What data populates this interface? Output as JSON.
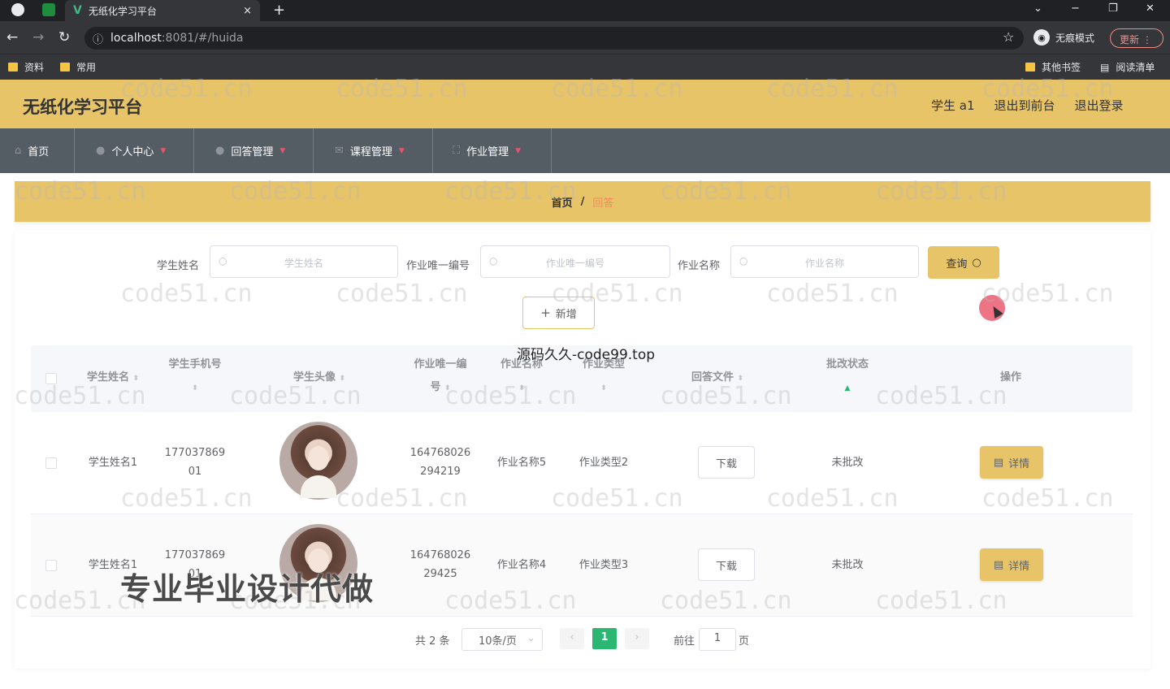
{
  "browser": {
    "tab_title": "无纸化学习平台",
    "tab_close": "×",
    "new_tab": "+",
    "url_host": "localhost",
    "url_path": ":8081/#/huida",
    "incognito_label": "无痕模式",
    "update_label": "更新",
    "win_minimize": "−",
    "win_restore": "❐",
    "win_close": "✕",
    "tab_list": "⌄",
    "bookmarks_left": [
      "资料",
      "常用"
    ],
    "bookmarks_right": [
      "其他书签",
      "阅读清单"
    ]
  },
  "app": {
    "title": "无纸化学习平台",
    "user_label": "学生 a1",
    "back_front": "退出到前台",
    "logout": "退出登录"
  },
  "menu": [
    {
      "label": "首页",
      "icon": "home-icon",
      "has_caret": false
    },
    {
      "label": "个人中心",
      "icon": "user-icon",
      "has_caret": true
    },
    {
      "label": "回答管理",
      "icon": "bulb-icon",
      "has_caret": true
    },
    {
      "label": "课程管理",
      "icon": "mail-icon",
      "has_caret": true
    },
    {
      "label": "作业管理",
      "icon": "crop-icon",
      "has_caret": true
    }
  ],
  "breadcrumb": {
    "home": "首页",
    "separator": "/",
    "current": "回答"
  },
  "search": {
    "fields": [
      {
        "label": "学生姓名",
        "placeholder": "学生姓名"
      },
      {
        "label": "作业唯一编号",
        "placeholder": "作业唯一编号"
      },
      {
        "label": "作业名称",
        "placeholder": "作业名称"
      }
    ],
    "query_button": "查询",
    "add_button": "新增"
  },
  "table": {
    "headers": {
      "student_name": "学生姓名",
      "student_phone": "学生手机号",
      "student_avatar": "学生头像",
      "homework_id_1": "作业唯一编",
      "homework_id_2": "号",
      "homework_name": "作业名称",
      "homework_type": "作业类型",
      "answer_file": "回答文件",
      "review_status": "批改状态",
      "actions": "操作"
    },
    "rows": [
      {
        "name": "学生姓名1",
        "phone_1": "177037869",
        "phone_2": "01",
        "hw_id_1": "164768026",
        "hw_id_2": "294219",
        "hw_name": "作业名称5",
        "hw_type": "作业类型2",
        "download": "下载",
        "status": "未批改",
        "detail": "详情"
      },
      {
        "name": "学生姓名1",
        "phone_1": "177037869",
        "phone_2": "01",
        "hw_id_1": "164768026",
        "hw_id_2": "29425",
        "hw_name": "作业名称4",
        "hw_type": "作业类型3",
        "download": "下载",
        "status": "未批改",
        "detail": "详情"
      }
    ]
  },
  "pagination": {
    "total": "共 2 条",
    "page_size": "10条/页",
    "current_page": "1",
    "prev": "‹",
    "next": "›",
    "goto_label": "前往",
    "goto_value": "1",
    "page_unit": "页"
  },
  "overlays": {
    "watermark": "code51.cn",
    "source_text": "源码久久-code99.top",
    "ad_text": "专业毕业设计代做"
  },
  "colors": {
    "header_bg": "#e8c469",
    "menu_bg": "#545c64",
    "active_page": "#2bb673",
    "breadcrumb_current": "#f08a5d"
  }
}
